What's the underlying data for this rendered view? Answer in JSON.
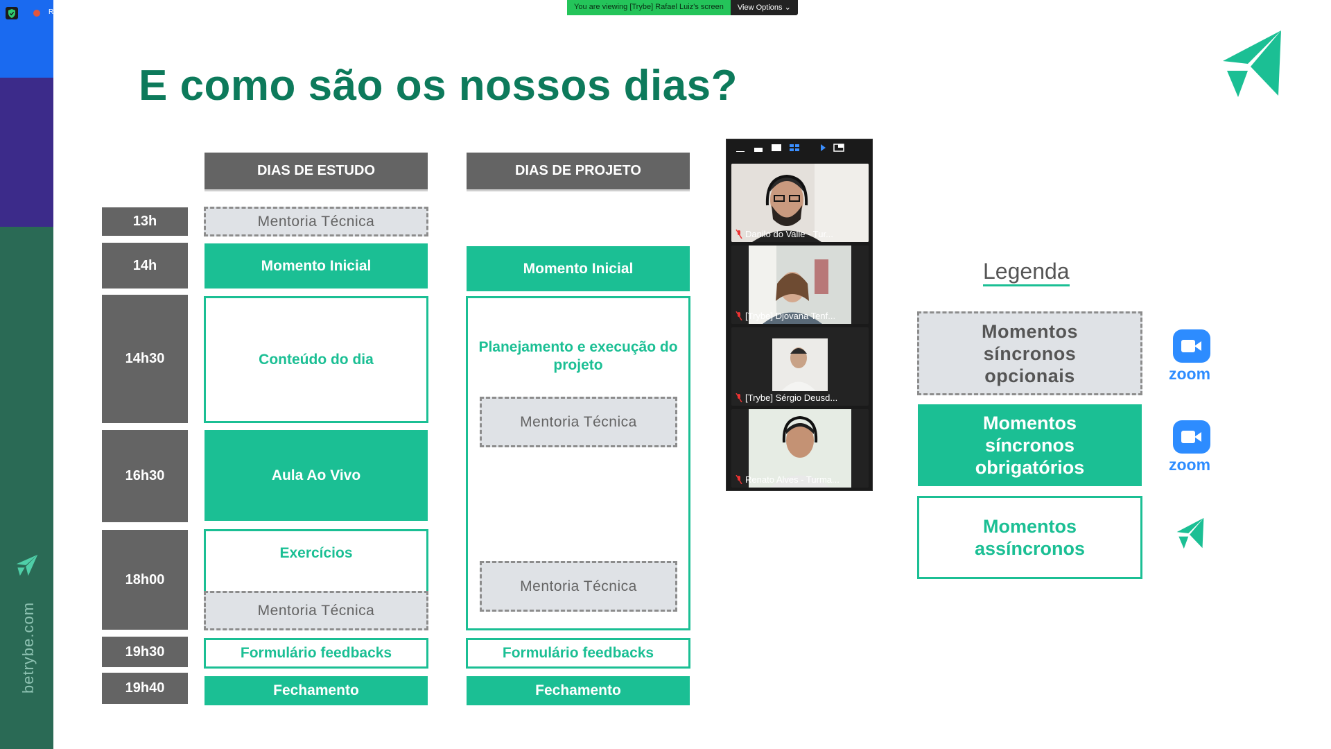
{
  "sidebar": {
    "url": "betrybe.com",
    "recording_label": "R"
  },
  "banner": {
    "text": "You are viewing [Trybe] Rafael Luiz's screen",
    "view_options": "View Options"
  },
  "slide": {
    "title": "E como são os nossos dias?",
    "columns": {
      "study_header": "DIAS DE ESTUDO",
      "project_header": "DIAS DE PROJETO"
    },
    "times": [
      "13h",
      "14h",
      "14h30",
      "16h30",
      "18h00",
      "19h30",
      "19h40"
    ],
    "study": {
      "mentoria_1": "Mentoria Técnica",
      "momento_inicial": "Momento Inicial",
      "conteudo": "Conteúdo do dia",
      "aula": "Aula Ao Vivo",
      "exercicios": "Exercícios",
      "mentoria_2": "Mentoria Técnica",
      "formulario": "Formulário feedbacks",
      "fechamento": "Fechamento"
    },
    "project": {
      "momento_inicial": "Momento Inicial",
      "planejamento": "Planejamento e execução do projeto",
      "mentoria_1": "Mentoria Técnica",
      "mentoria_2": "Mentoria Técnica",
      "formulario": "Formulário feedbacks",
      "fechamento": "Fechamento"
    },
    "legend": {
      "title": "Legenda",
      "optional": "Momentos síncronos opcionais",
      "mandatory": "Momentos síncronos obrigatórios",
      "async": "Momentos assíncronos",
      "zoom_word": "zoom"
    }
  },
  "participants": [
    {
      "name": "Danilo do Valle - Tur..."
    },
    {
      "name": "[Trybe] Djovana Tenf..."
    },
    {
      "name": "[Trybe] Sérgio Deusd..."
    },
    {
      "name": "Renato Alves - Turma..."
    }
  ],
  "colors": {
    "accent": "#1bbf94",
    "title": "#0d7a5b",
    "gray": "#646464",
    "zoom": "#2d8cff",
    "banner": "#24c45a"
  }
}
